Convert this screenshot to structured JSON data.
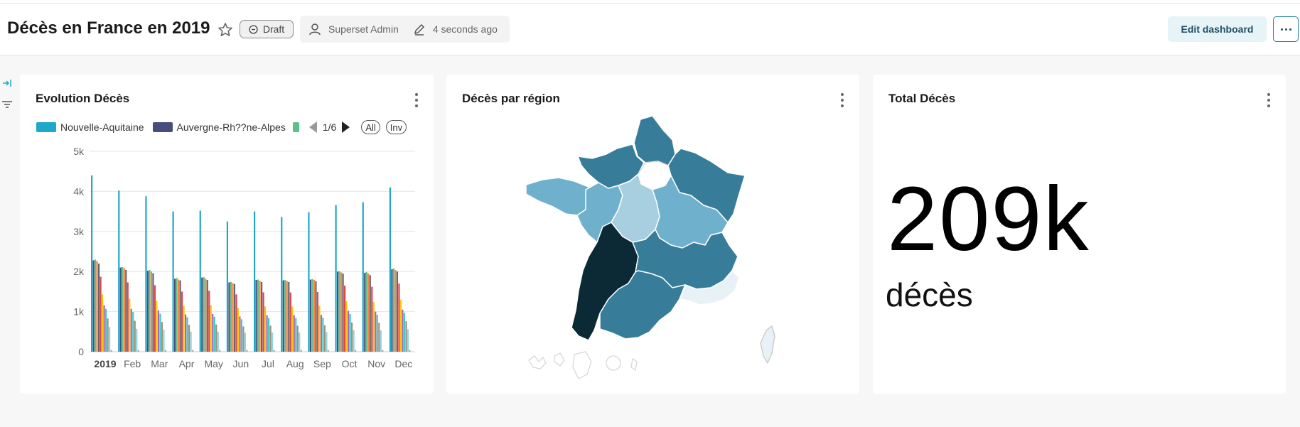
{
  "header": {
    "title": "Décès en France en 2019",
    "draft_label": "Draft",
    "owner": "Superset Admin",
    "modified": "4 seconds ago",
    "edit_label": "Edit dashboard"
  },
  "cards": {
    "evolution": {
      "title": "Evolution Décès",
      "legend": {
        "items": [
          {
            "label": "Nouvelle-Aquitaine",
            "color": "#1fa8c9"
          },
          {
            "label": "Auvergne-Rh??ne-Alpes",
            "color": "#454e7c"
          }
        ],
        "third_color": "#5ac189",
        "page": "1/6",
        "all_label": "All",
        "inv_label": "Inv"
      }
    },
    "map": {
      "title": "Décès par région"
    },
    "total": {
      "title": "Total Décès",
      "value": "209k",
      "subtitle": "décès"
    }
  },
  "chart_data": {
    "type": "bar",
    "categories": [
      "2019",
      "Feb",
      "Mar",
      "Apr",
      "May",
      "Jun",
      "Jul",
      "Aug",
      "Sep",
      "Oct",
      "Nov",
      "Dec"
    ],
    "ylim": [
      0,
      5000
    ],
    "yticks": [
      "0",
      "1k",
      "2k",
      "3k",
      "4k",
      "5k"
    ],
    "grid": true,
    "series": [
      {
        "name": "Nouvelle-Aquitaine",
        "color": "#1fa8c9",
        "values": [
          4400,
          4020,
          3880,
          3500,
          3520,
          3250,
          3500,
          3360,
          3480,
          3660,
          3730,
          4100
        ]
      },
      {
        "name": "Auvergne-Rh??ne-Alpes",
        "color": "#454e7c",
        "values": [
          2280,
          2100,
          2020,
          1820,
          1850,
          1730,
          1790,
          1780,
          1800,
          2000,
          1970,
          2060
        ]
      },
      {
        "color": "#5ac189",
        "values": [
          2300,
          2110,
          2040,
          1840,
          1860,
          1740,
          1800,
          1790,
          1810,
          2010,
          1990,
          2080
        ]
      },
      {
        "color": "#ff7f44",
        "values": [
          2260,
          2080,
          2000,
          1800,
          1820,
          1710,
          1770,
          1760,
          1790,
          1980,
          1950,
          2040
        ]
      },
      {
        "color": "#666666",
        "values": [
          2200,
          2040,
          1960,
          1780,
          1790,
          1690,
          1740,
          1740,
          1760,
          1950,
          1910,
          2000
        ]
      },
      {
        "color": "#e04355",
        "values": [
          1870,
          1730,
          1660,
          1500,
          1520,
          1430,
          1480,
          1480,
          1490,
          1650,
          1620,
          1700
        ]
      },
      {
        "color": "#fcc700",
        "values": [
          1430,
          1320,
          1270,
          1140,
          1160,
          1090,
          1130,
          1130,
          1140,
          1260,
          1240,
          1300
        ]
      },
      {
        "color": "#a868b7",
        "values": [
          1160,
          1070,
          1030,
          930,
          940,
          880,
          910,
          910,
          920,
          1020,
          1000,
          1050
        ]
      },
      {
        "color": "#3ccccb",
        "values": [
          1070,
          990,
          950,
          860,
          870,
          810,
          840,
          840,
          850,
          940,
          920,
          970
        ]
      },
      {
        "color": "#a38f79",
        "values": [
          830,
          770,
          740,
          670,
          680,
          630,
          650,
          650,
          660,
          730,
          720,
          760
        ]
      },
      {
        "color": "#8fd3e4",
        "values": [
          620,
          570,
          550,
          500,
          500,
          470,
          480,
          480,
          490,
          540,
          530,
          560
        ]
      },
      {
        "color": "#a1a6bd",
        "values": [
          40,
          40,
          40,
          40,
          40,
          40,
          40,
          40,
          40,
          40,
          40,
          40
        ]
      }
    ]
  }
}
